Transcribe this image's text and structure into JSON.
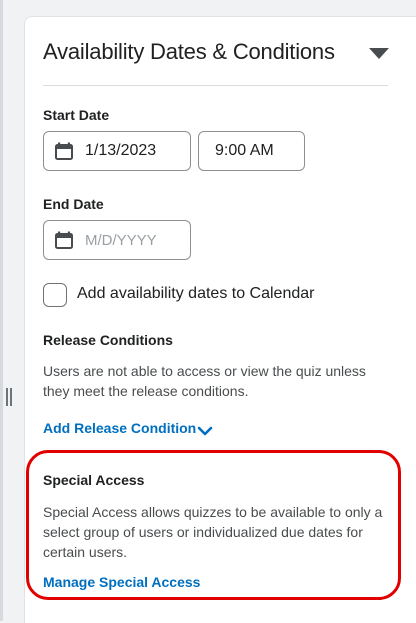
{
  "panel": {
    "title": "Availability Dates & Conditions"
  },
  "start_date": {
    "label": "Start Date",
    "date_value": "1/13/2023",
    "time_value": "9:00 AM"
  },
  "end_date": {
    "label": "End Date",
    "date_placeholder": "M/D/YYYY"
  },
  "calendar_option": {
    "label": "Add availability dates to Calendar",
    "checked": false
  },
  "release_conditions": {
    "heading": "Release Conditions",
    "description": "Users are not able to access or view the quiz unless they meet the release conditions.",
    "add_link": "Add Release Condition"
  },
  "special_access": {
    "heading": "Special Access",
    "description": "Special Access allows quizzes to be available to only a select group of users or individualized due dates for certain users.",
    "manage_link": "Manage Special Access",
    "highlight_color": "#e00000"
  },
  "colors": {
    "link": "#006fbf",
    "text": "#202122",
    "muted_text": "#494c4e"
  },
  "icons": {
    "collapse": "caret-down-icon",
    "calendar": "calendar-icon",
    "add_release_chevron": "chevron-down-icon"
  }
}
